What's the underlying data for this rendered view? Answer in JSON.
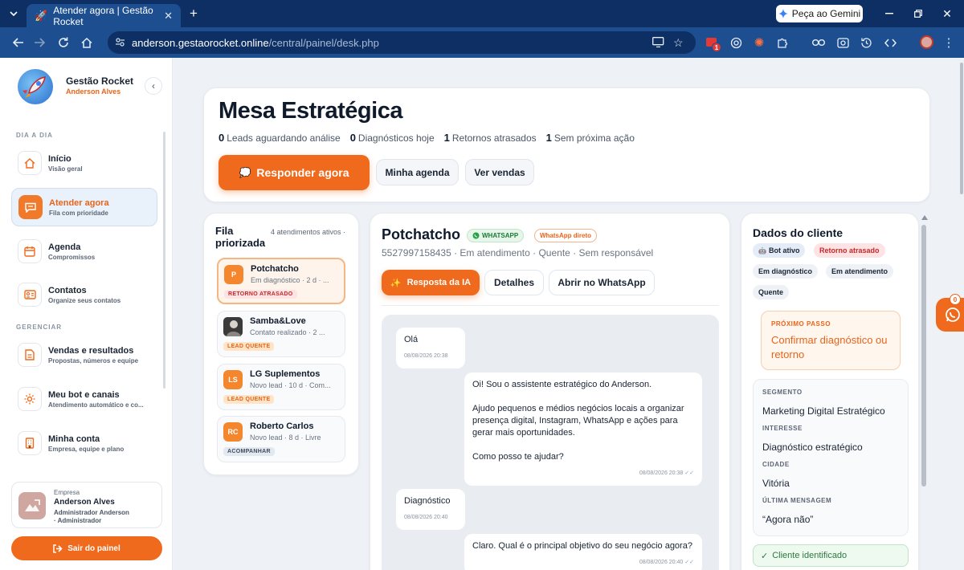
{
  "browser": {
    "tab_title": "Atender agora | Gestão Rocket",
    "tab_icon": "🚀",
    "gemini_label": "Peça ao Gemini",
    "url_host": "anderson.gestaorocket.online",
    "url_path": "/central/painel/desk.php",
    "extension_badge": "1"
  },
  "sidebar": {
    "brand_name": "Gestão Rocket",
    "brand_user": "Anderson Alves",
    "section_daily": "DIA A DIA",
    "section_manage": "GERENCIAR",
    "items": [
      {
        "label": "Início",
        "sub": "Visão geral",
        "icon": "home-icon"
      },
      {
        "label": "Atender agora",
        "sub": "Fila com prioridade",
        "icon": "chat-icon"
      },
      {
        "label": "Agenda",
        "sub": "Compromissos",
        "icon": "calendar-icon"
      },
      {
        "label": "Contatos",
        "sub": "Organize seus contatos",
        "icon": "contact-card-icon"
      },
      {
        "label": "Vendas e resultados",
        "sub": "Propostas, números e equipe",
        "icon": "document-icon"
      },
      {
        "label": "Meu bot e canais",
        "sub": "Atendimento automático e co...",
        "icon": "gear-icon"
      },
      {
        "label": "Minha conta",
        "sub": "Empresa, equipe e plano",
        "icon": "building-icon"
      }
    ],
    "company_label": "Empresa",
    "company_name": "Anderson Alves",
    "company_role_1": "Administrador Anderson",
    "company_role_2": "· Administrador",
    "logout_label": "Sair do painel"
  },
  "hero": {
    "title": "Mesa Estratégica",
    "stats": [
      {
        "value": "0",
        "label": "Leads aguardando análise"
      },
      {
        "value": "0",
        "label": "Diagnósticos hoje"
      },
      {
        "value": "1",
        "label": "Retornos atrasados"
      },
      {
        "value": "1",
        "label": "Sem próxima ação"
      }
    ],
    "primary_label": "Responder agora",
    "btn_agenda": "Minha agenda",
    "btn_sales": "Ver vendas"
  },
  "queue": {
    "title_1": "Fila",
    "title_2": "priorizada",
    "count": "4 atendimentos ativos ·",
    "items": [
      {
        "initials": "P",
        "name": "Potchatcho",
        "status": "Em diagnóstico · 2 d · ...",
        "tag": "RETORNO ATRASADO"
      },
      {
        "initials": "",
        "name": "Samba&Love",
        "status": "Contato realizado · 2 ...",
        "tag": "LEAD QUENTE"
      },
      {
        "initials": "LS",
        "name": "LG Suplementos",
        "status": "Novo lead · 10 d · Com...",
        "tag": "LEAD QUENTE"
      },
      {
        "initials": "RC",
        "name": "Roberto Carlos",
        "status": "Novo lead · 8 d · Livre",
        "tag": "ACOMPANHAR"
      }
    ]
  },
  "chat": {
    "name": "Potchatcho",
    "channel_badge": "WHATSAPP",
    "direct_badge": "WhatsApp direto",
    "meta": "5527997158435 · Em atendimento · Quente · Sem responsável",
    "btn_ai": "Resposta da IA",
    "btn_details": "Detalhes",
    "btn_whatsapp": "Abrir no WhatsApp",
    "messages": [
      {
        "text": "Olá",
        "time": "08/08/2026 20:38"
      },
      {
        "p1": "Oi! Sou o assistente estratégico do Anderson.",
        "p2": "Ajudo pequenos e médios negócios locais a organizar presença digital, Instagram, WhatsApp e ações para gerar mais oportunidades.",
        "p3": "Como posso te ajudar?",
        "time": "08/08/2026 20:38"
      },
      {
        "text": "Diagnóstico",
        "time": "08/08/2026 20:40"
      },
      {
        "text": "Claro. Qual é o principal objetivo do seu negócio agora?",
        "time": "08/08/2026 20:40"
      }
    ]
  },
  "client": {
    "title": "Dados do cliente",
    "chips": [
      "Bot ativo",
      "Retorno atrasado",
      "Em diagnóstico",
      "Em atendimento",
      "Quente"
    ],
    "next_step_label": "PRÓXIMO PASSO",
    "next_step_value": "Confirmar diagnóstico ou retorno",
    "fields": [
      {
        "key": "SEGMENTO",
        "value": "Marketing Digital Estratégico"
      },
      {
        "key": "INTERESSE",
        "value": "Diagnóstico estratégico"
      },
      {
        "key": "CIDADE",
        "value": "Vitória"
      },
      {
        "key": "ÚLTIMA MENSAGEM",
        "value": "“Agora não”"
      }
    ],
    "identified": "Cliente identificado"
  },
  "fab_badge": "0",
  "colors": {
    "accent": "#ef6a1c",
    "browser_dark": "#0e2f63",
    "browser_bar": "#1d4e8f",
    "whatsapp": "#25a244"
  }
}
